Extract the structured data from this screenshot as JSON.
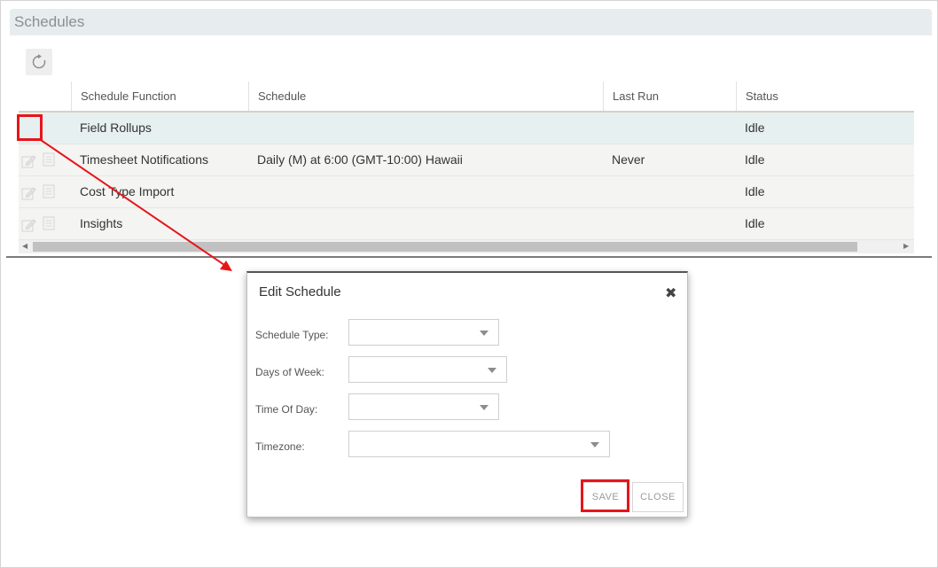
{
  "page": {
    "title": "Schedules"
  },
  "toolbar": {
    "refresh_icon": "refresh-icon"
  },
  "table": {
    "columns": [
      "Schedule Function",
      "Schedule",
      "Last Run",
      "Status"
    ],
    "rows": [
      {
        "function": "Field Rollups",
        "schedule": "",
        "last_run": "",
        "status": "Idle"
      },
      {
        "function": "Timesheet Notifications",
        "schedule": "Daily (M) at 6:00 (GMT-10:00) Hawaii",
        "last_run": "Never",
        "status": "Idle"
      },
      {
        "function": "Cost Type Import",
        "schedule": "",
        "last_run": "",
        "status": "Idle"
      },
      {
        "function": "Insights",
        "schedule": "",
        "last_run": "",
        "status": "Idle"
      }
    ]
  },
  "dialog": {
    "title": "Edit Schedule",
    "fields": {
      "schedule_type": {
        "label": "Schedule Type:",
        "value": ""
      },
      "days_of_week": {
        "label": "Days of Week:",
        "value": ""
      },
      "time_of_day": {
        "label": "Time Of Day:",
        "value": ""
      },
      "timezone": {
        "label": "Timezone:",
        "value": ""
      }
    },
    "save_label": "SAVE",
    "close_label": "CLOSE"
  },
  "colors": {
    "annotation_red": "#e8141a",
    "header_bg": "#e7ecef",
    "selected_row": "#e6f0f0"
  }
}
